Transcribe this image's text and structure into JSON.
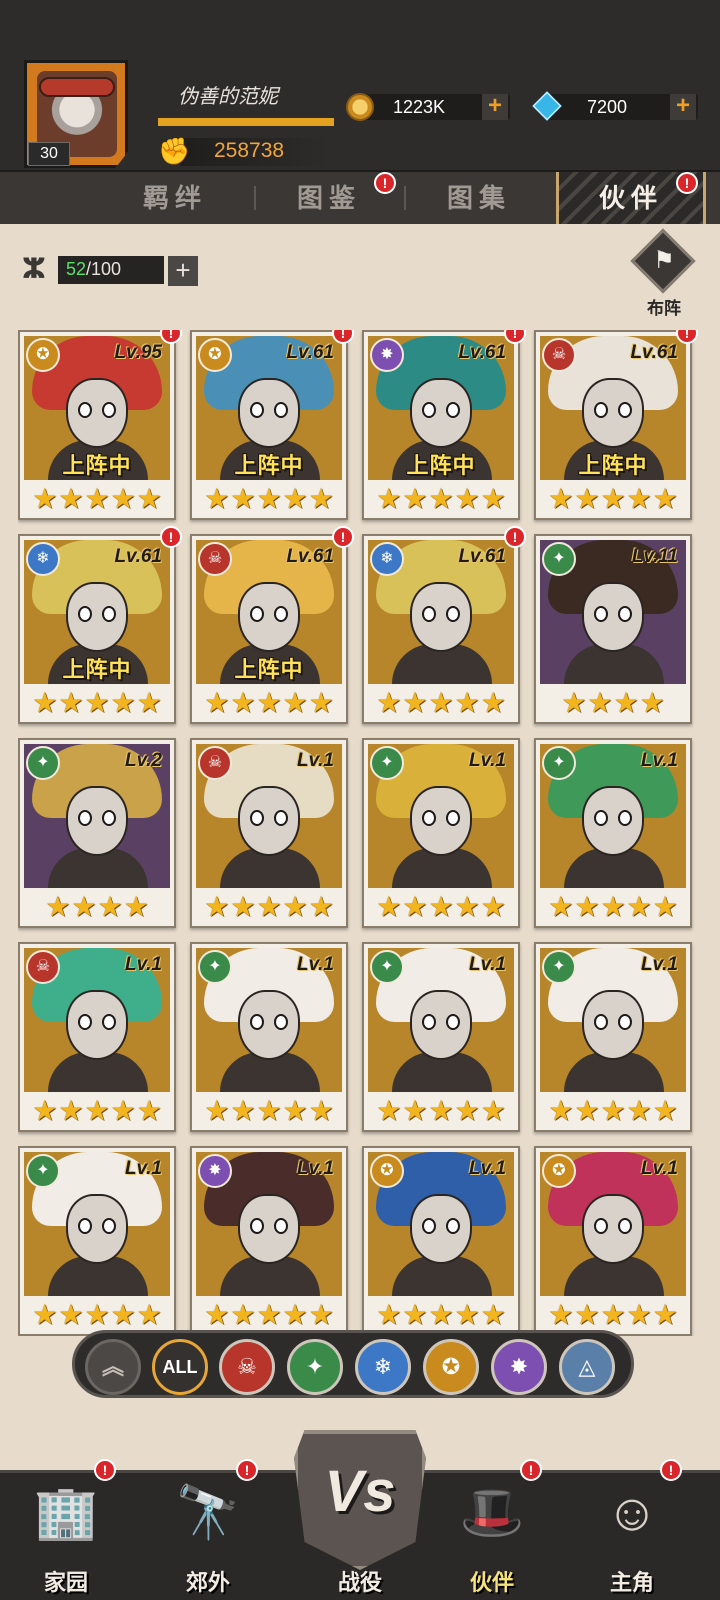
{
  "player": {
    "name": "伪善的范妮",
    "level": "30",
    "exp_fraction": 1.0,
    "power": "258738"
  },
  "currencies": {
    "coins": "1223K",
    "gems": "7200",
    "plus": "+"
  },
  "tabs": [
    {
      "label": "羁绊",
      "alert": false,
      "active": false
    },
    {
      "label": "图鉴",
      "alert": true,
      "active": false
    },
    {
      "label": "图集",
      "alert": false,
      "active": false
    },
    {
      "label": "伙伴",
      "alert": true,
      "active": true
    }
  ],
  "capacity": {
    "current": "52",
    "max": "/100",
    "plus": "+"
  },
  "formation": {
    "label": "布阵",
    "icon": "flag-icon"
  },
  "alert_mark": "!",
  "deployed_label": "上阵中",
  "factions": {
    "sun": {
      "color": "#c98b1e",
      "glyph": "✪"
    },
    "void": {
      "color": "#7d4fb0",
      "glyph": "✸"
    },
    "skull": {
      "color": "#b8352b",
      "glyph": "☠"
    },
    "ice": {
      "color": "#3c78c6",
      "glyph": "❄"
    },
    "nature": {
      "color": "#3a8a4a",
      "glyph": "✦"
    },
    "arcane": {
      "color": "#5a7fa8",
      "glyph": "◬"
    }
  },
  "partners": [
    {
      "faction": "sun",
      "level": "Lv.95",
      "stars": 5,
      "deployed": true,
      "alert": true,
      "hair": "#c73a31",
      "bg": "gold"
    },
    {
      "faction": "sun",
      "level": "Lv.61",
      "stars": 5,
      "deployed": true,
      "alert": true,
      "hair": "#4a8fb5",
      "bg": "gold"
    },
    {
      "faction": "void",
      "level": "Lv.61",
      "stars": 5,
      "deployed": true,
      "alert": true,
      "hair": "#2c8c85",
      "bg": "gold"
    },
    {
      "faction": "skull",
      "level": "Lv.61",
      "stars": 5,
      "deployed": true,
      "alert": true,
      "hair": "#e8e2d8",
      "bg": "gold"
    },
    {
      "faction": "ice",
      "level": "Lv.61",
      "stars": 5,
      "deployed": true,
      "alert": true,
      "hair": "#d9c15a",
      "bg": "gold"
    },
    {
      "faction": "skull",
      "level": "Lv.61",
      "stars": 5,
      "deployed": true,
      "alert": true,
      "hair": "#e6b54a",
      "bg": "gold"
    },
    {
      "faction": "ice",
      "level": "Lv.61",
      "stars": 5,
      "deployed": false,
      "alert": true,
      "hair": "#d9c15a",
      "bg": "gold"
    },
    {
      "faction": "nature",
      "level": "Lv.11",
      "stars": 4,
      "deployed": false,
      "alert": false,
      "hair": "#3b2a22",
      "bg": "purple"
    },
    {
      "faction": "nature",
      "level": "Lv.2",
      "stars": 4,
      "deployed": false,
      "alert": false,
      "hair": "#c9a24a",
      "bg": "purple"
    },
    {
      "faction": "skull",
      "level": "Lv.1",
      "stars": 5,
      "deployed": false,
      "alert": false,
      "hair": "#e6dcc4",
      "bg": "gold"
    },
    {
      "faction": "nature",
      "level": "Lv.1",
      "stars": 5,
      "deployed": false,
      "alert": false,
      "hair": "#d9b03a",
      "bg": "gold"
    },
    {
      "faction": "nature",
      "level": "Lv.1",
      "stars": 5,
      "deployed": false,
      "alert": false,
      "hair": "#3f9a5a",
      "bg": "gold"
    },
    {
      "faction": "skull",
      "level": "Lv.1",
      "stars": 5,
      "deployed": false,
      "alert": false,
      "hair": "#3fae8a",
      "bg": "gold"
    },
    {
      "faction": "nature",
      "level": "Lv.1",
      "stars": 5,
      "deployed": false,
      "alert": false,
      "hair": "#f1ede6",
      "bg": "gold"
    },
    {
      "faction": "nature",
      "level": "Lv.1",
      "stars": 5,
      "deployed": false,
      "alert": false,
      "hair": "#f1ede6",
      "bg": "gold"
    },
    {
      "faction": "nature",
      "level": "Lv.1",
      "stars": 5,
      "deployed": false,
      "alert": false,
      "hair": "#f1ede6",
      "bg": "gold"
    },
    {
      "faction": "nature",
      "level": "Lv.1",
      "stars": 5,
      "deployed": false,
      "alert": false,
      "hair": "#f1ede6",
      "bg": "gold"
    },
    {
      "faction": "void",
      "level": "Lv.1",
      "stars": 5,
      "deployed": false,
      "alert": false,
      "hair": "#4a2c2a",
      "bg": "gold"
    },
    {
      "faction": "sun",
      "level": "Lv.1",
      "stars": 5,
      "deployed": false,
      "alert": false,
      "hair": "#2f5fa8",
      "bg": "gold"
    },
    {
      "faction": "sun",
      "level": "Lv.1",
      "stars": 5,
      "deployed": false,
      "alert": false,
      "hair": "#c0325a",
      "bg": "gold"
    }
  ],
  "filters": {
    "collapse_glyph": "︽",
    "all_label": "ALL",
    "items": [
      "skull",
      "nature",
      "ice",
      "sun",
      "void",
      "arcane"
    ]
  },
  "bottom_nav": [
    {
      "label": "家园",
      "icon": "building-icon",
      "glyph": "🏢",
      "alert": true,
      "active": false
    },
    {
      "label": "郊外",
      "icon": "telescope-icon",
      "glyph": "🔭",
      "alert": true,
      "active": false
    },
    {
      "label": "战役",
      "icon": "vs-shield-icon",
      "glyph": "",
      "alert": false,
      "active": false
    },
    {
      "label": "伙伴",
      "icon": "hat-icon",
      "glyph": "🎩",
      "alert": true,
      "active": true
    },
    {
      "label": "主角",
      "icon": "hero-icon",
      "glyph": "☺",
      "alert": true,
      "active": false
    }
  ],
  "vs_text": "Vs"
}
